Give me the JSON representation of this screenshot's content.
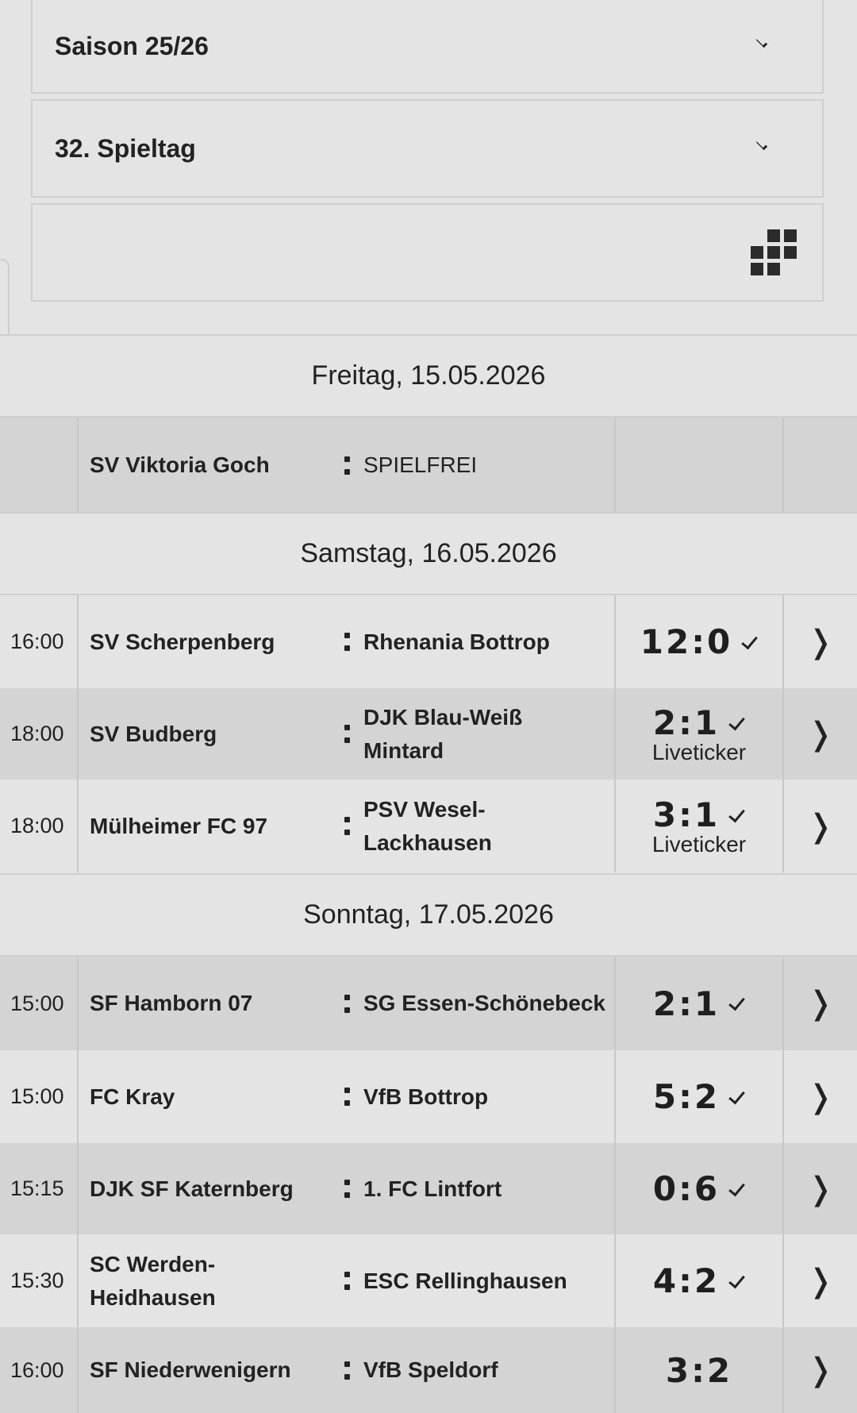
{
  "filters": {
    "season": "Saison 25/26",
    "matchday": "32. Spieltag"
  },
  "days": [
    {
      "date": "Freitag, 15.05.2026",
      "matches": [
        {
          "time": "",
          "home": "SV Viktoria Goch",
          "away": "SPIELFREI",
          "score": "",
          "finished": false,
          "liveticker": ""
        }
      ]
    },
    {
      "date": "Samstag, 16.05.2026",
      "matches": [
        {
          "time": "16:00",
          "home": "SV Scherpenberg",
          "away": "Rhenania Bottrop",
          "score": "12:0",
          "finished": true,
          "liveticker": ""
        },
        {
          "time": "18:00",
          "home": "SV Budberg",
          "away": "DJK Blau-Weiß Mintard",
          "score": "2:1",
          "finished": true,
          "liveticker": "Liveticker"
        },
        {
          "time": "18:00",
          "home": "Mülheimer FC 97",
          "away": "PSV Wesel-Lackhausen",
          "score": "3:1",
          "finished": true,
          "liveticker": "Liveticker"
        }
      ]
    },
    {
      "date": "Sonntag, 17.05.2026",
      "matches": [
        {
          "time": "15:00",
          "home": "SF Hamborn 07",
          "away": "SG Essen-Schönebeck",
          "score": "2:1",
          "finished": true,
          "liveticker": ""
        },
        {
          "time": "15:00",
          "home": "FC Kray",
          "away": "VfB Bottrop",
          "score": "5:2",
          "finished": true,
          "liveticker": ""
        },
        {
          "time": "15:15",
          "home": "DJK SF Katernberg",
          "away": "1. FC Lintfort",
          "score": "0:6",
          "finished": true,
          "liveticker": ""
        },
        {
          "time": "15:30",
          "home": "SC Werden-Heidhausen",
          "away": "ESC Rellinghausen",
          "score": "4:2",
          "finished": true,
          "liveticker": ""
        },
        {
          "time": "16:00",
          "home": "SF Niederwenigern",
          "away": "VfB Speldorf",
          "score": "3:2",
          "finished": false,
          "liveticker": ""
        }
      ]
    }
  ],
  "icons": {
    "dropdown": "chevron-down-icon",
    "view_toggle": "grid-icon",
    "detail": "chevron-right-icon",
    "finished": "checkmark-icon"
  },
  "colors": {
    "background": "#e4e4e4",
    "row_alt": "#d4d4d4",
    "border": "#cfcfcf",
    "text": "#222222"
  }
}
